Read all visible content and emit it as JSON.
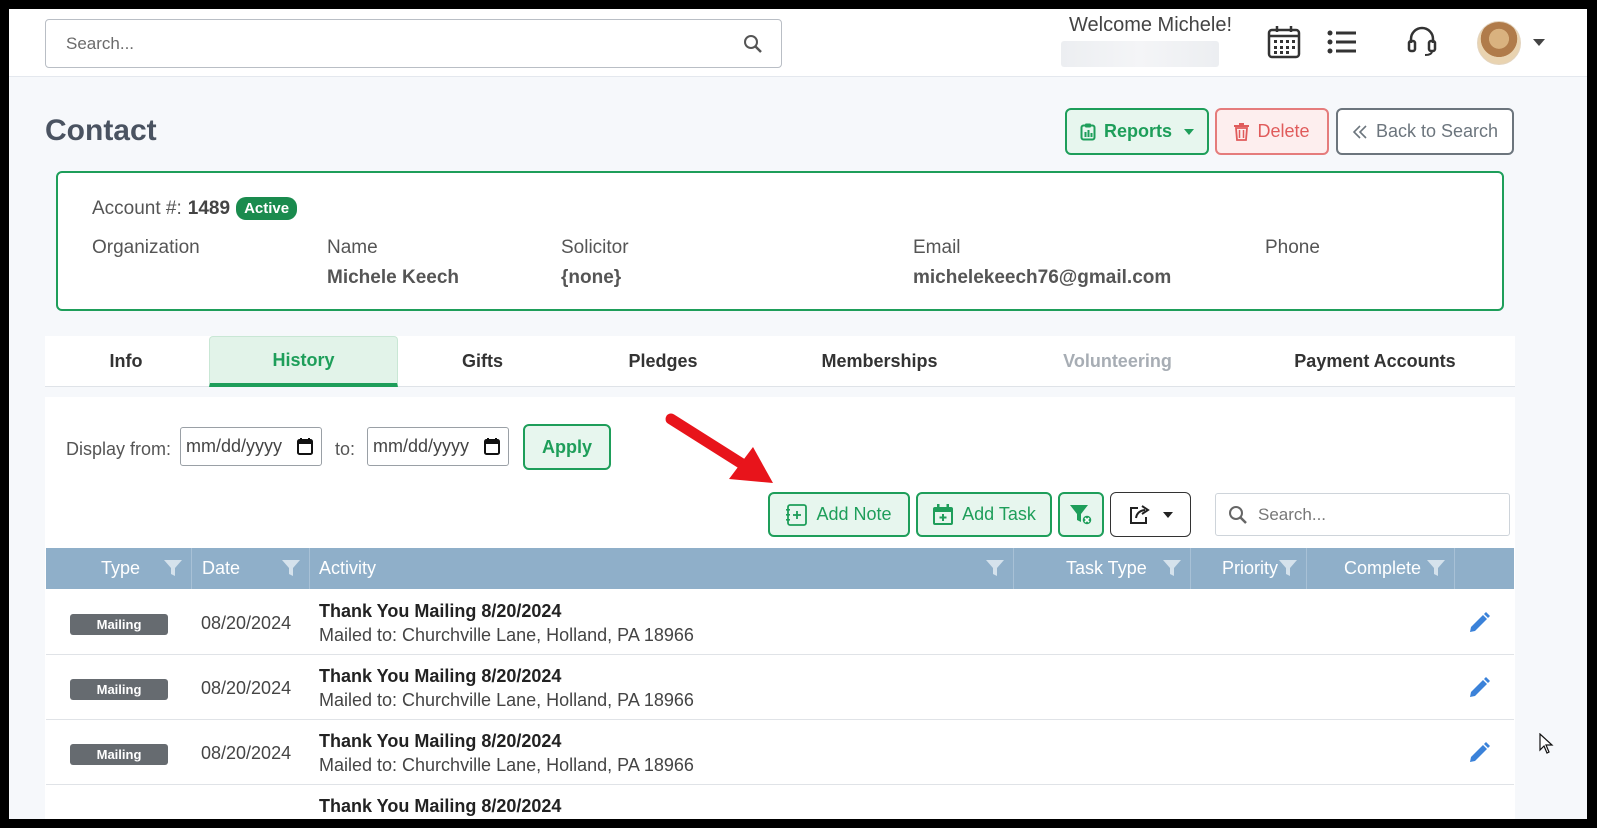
{
  "header": {
    "search_placeholder": "Search...",
    "welcome": "Welcome Michele!"
  },
  "page": {
    "title": "Contact",
    "reports_label": "Reports",
    "delete_label": "Delete",
    "back_label": "Back to Search"
  },
  "account": {
    "label": "Account #:",
    "number": "1489",
    "status": "Active",
    "fields": [
      {
        "label": "Organization",
        "value": ""
      },
      {
        "label": "Name",
        "value": "Michele Keech"
      },
      {
        "label": "Solicitor",
        "value": "{none}"
      },
      {
        "label": "Email",
        "value": "michelekeech76@gmail.com"
      },
      {
        "label": "Phone",
        "value": ""
      }
    ]
  },
  "tabs": [
    {
      "label": "Info",
      "state": "normal"
    },
    {
      "label": "History",
      "state": "active"
    },
    {
      "label": "Gifts",
      "state": "normal"
    },
    {
      "label": "Pledges",
      "state": "normal"
    },
    {
      "label": "Memberships",
      "state": "normal"
    },
    {
      "label": "Volunteering",
      "state": "disabled"
    },
    {
      "label": "Payment Accounts",
      "state": "normal"
    }
  ],
  "history": {
    "display_from_label": "Display from:",
    "to_label": "to:",
    "from_placeholder": "mm/dd/yyyy",
    "to_placeholder": "mm/dd/yyyy",
    "apply_label": "Apply",
    "add_note_label": "Add Note",
    "add_task_label": "Add Task",
    "search_placeholder": "Search...",
    "columns": [
      "Type",
      "Date",
      "Activity",
      "Task Type",
      "Priority",
      "Complete"
    ],
    "rows": [
      {
        "type": "Mailing",
        "date": "08/20/2024",
        "title": "Thank You Mailing 8/20/2024",
        "detail": "Mailed to: Churchville Lane, Holland, PA 18966"
      },
      {
        "type": "Mailing",
        "date": "08/20/2024",
        "title": "Thank You Mailing 8/20/2024",
        "detail": "Mailed to: Churchville Lane, Holland, PA 18966"
      },
      {
        "type": "Mailing",
        "date": "08/20/2024",
        "title": "Thank You Mailing 8/20/2024",
        "detail": "Mailed to: Churchville Lane, Holland, PA 18966"
      },
      {
        "type": "",
        "date": "",
        "title": "Thank You Mailing 8/20/2024",
        "detail": ""
      }
    ]
  },
  "colors": {
    "accent_green": "#1e9e5a",
    "danger": "#e05b5b",
    "grid_header": "#8fafc9",
    "arrow_red": "#e8141b"
  },
  "icons": [
    "search-icon",
    "calendar-icon",
    "list-icon",
    "headset-icon",
    "clipboard-icon",
    "trash-icon",
    "double-chevron-left-icon",
    "note-add-icon",
    "calendar-add-icon",
    "filter-clear-icon",
    "export-icon",
    "funnel-icon",
    "pencil-icon"
  ]
}
